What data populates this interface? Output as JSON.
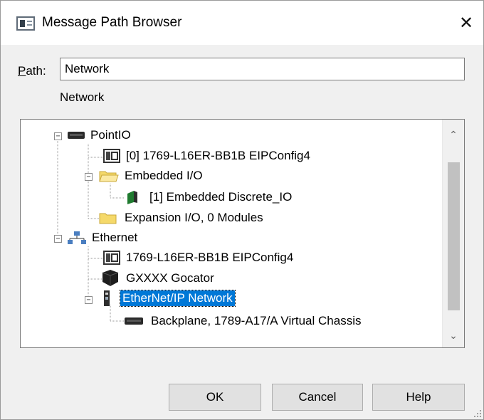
{
  "window": {
    "title": "Message Path Browser",
    "close_glyph": "✕",
    "icon": "window-app-icon"
  },
  "path": {
    "label": "Path:",
    "value": "Network",
    "display": "Network"
  },
  "tree": {
    "nodes": [
      {
        "label": "PointIO",
        "icon": "backplane-icon",
        "expander": "−"
      },
      {
        "label": "[0] 1769-L16ER-BB1B EIPConfig4",
        "icon": "controller-module-icon"
      },
      {
        "label": "Embedded I/O",
        "icon": "open-folder-icon",
        "expander": "−"
      },
      {
        "label": "[1] Embedded Discrete_IO",
        "icon": "io-module-icon"
      },
      {
        "label": "Expansion I/O, 0 Modules",
        "icon": "folder-icon"
      },
      {
        "label": "Ethernet",
        "icon": "network-icon",
        "expander": "−"
      },
      {
        "label": "1769-L16ER-BB1B EIPConfig4",
        "icon": "controller-module-icon"
      },
      {
        "label": "GXXXX Gocator",
        "icon": "sensor-device-icon"
      },
      {
        "label": "EtherNet/IP Network",
        "icon": "ethernet-port-icon",
        "expander": "−",
        "selected": true
      },
      {
        "label": "Backplane, 1789-A17/A Virtual Chassis",
        "icon": "backplane-icon"
      }
    ]
  },
  "scrollbar": {
    "up": "⌃",
    "down": "⌄"
  },
  "buttons": {
    "ok": "OK",
    "cancel": "Cancel",
    "help": "Help"
  }
}
